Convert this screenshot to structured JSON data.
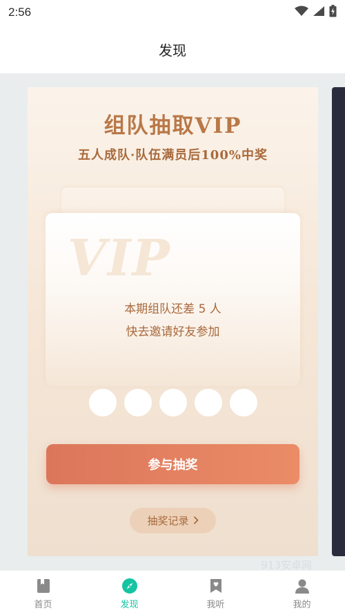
{
  "status_bar": {
    "time": "2:56"
  },
  "header": {
    "title": "发现"
  },
  "card": {
    "title": "组队抽取VIP",
    "subtitle": "五人成队·队伍满员后100%中奖",
    "watermark_text": "VIP",
    "team_status": "本期组队还差 5 人",
    "invite_text": "快去邀请好友参加",
    "slots_empty": 5,
    "join_label": "参与抽奖",
    "records_label": "抽奖记录"
  },
  "site_watermark": "913安卓网",
  "bottom_nav": {
    "items": [
      {
        "label": "首页",
        "icon": "book-icon",
        "active": false
      },
      {
        "label": "发现",
        "icon": "compass-icon",
        "active": true
      },
      {
        "label": "我听",
        "icon": "bookmark-heart-icon",
        "active": false
      },
      {
        "label": "我的",
        "icon": "person-icon",
        "active": false
      }
    ]
  },
  "colors": {
    "accent": "#14c4a3",
    "brand_gold": "#b97848",
    "button_start": "#dc765b",
    "button_end": "#ea8c66"
  }
}
